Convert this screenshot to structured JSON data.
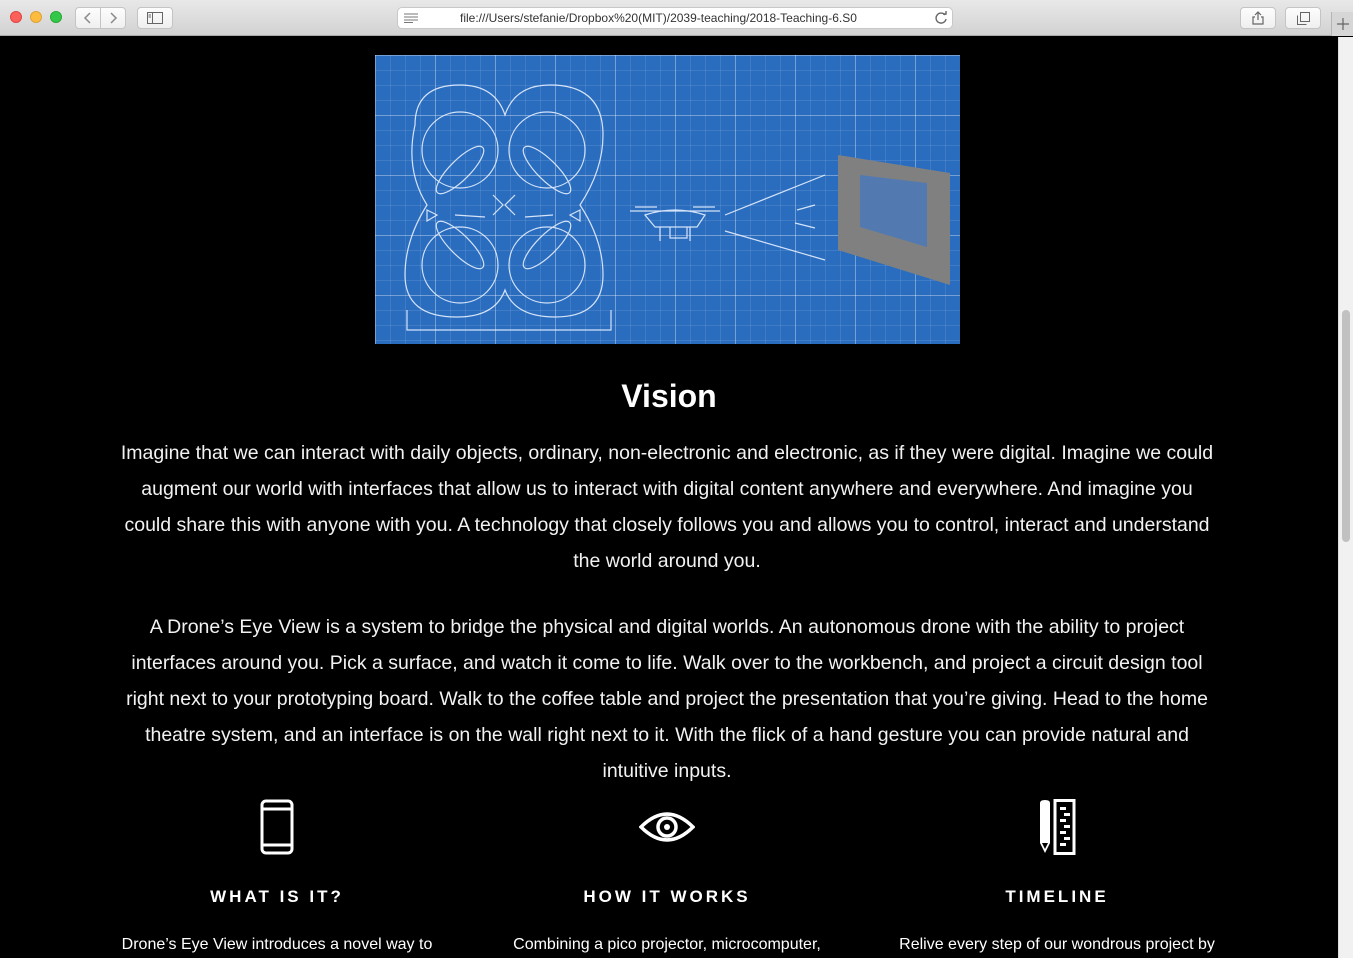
{
  "browser": {
    "url": "file:///Users/stefanie/Dropbox%20(MIT)/2039-teaching/2018-Teaching-6.S0"
  },
  "page": {
    "hero_image": "drone-blueprint-illustration",
    "vision": {
      "title": "Vision",
      "paragraphs": [
        "Imagine that we can interact with daily objects, ordinary, non-electronic and electronic, as if they were digital. Imagine we could augment our world with interfaces that allow us to interact with digital content anywhere and everywhere. And imagine you could share this with anyone with you. A technology that closely follows you and allows you to control, interact and understand the world around you.",
        "A Drone’s Eye View is a system to bridge the physical and digital worlds. An autonomous drone with the ability to project interfaces around you. Pick a surface, and watch it come to life. Walk over to the workbench, and project a circuit design tool right next to your prototyping board. Walk to the coffee table and project the presentation that you’re giving. Head to the home theatre system, and an interface is on the wall right next to it. With the flick of a hand gesture you can provide natural and intuitive inputs."
      ]
    },
    "features": [
      {
        "icon": "smartphone-icon",
        "title": "WHAT IS IT?",
        "text": "Drone’s Eye View introduces a novel way to"
      },
      {
        "icon": "eye-icon",
        "title": "HOW IT WORKS",
        "text": "Combining a pico projector, microcomputer,"
      },
      {
        "icon": "pencil-ruler-icon",
        "title": "TIMELINE",
        "text": "Relive every step of our wondrous project by"
      }
    ]
  }
}
